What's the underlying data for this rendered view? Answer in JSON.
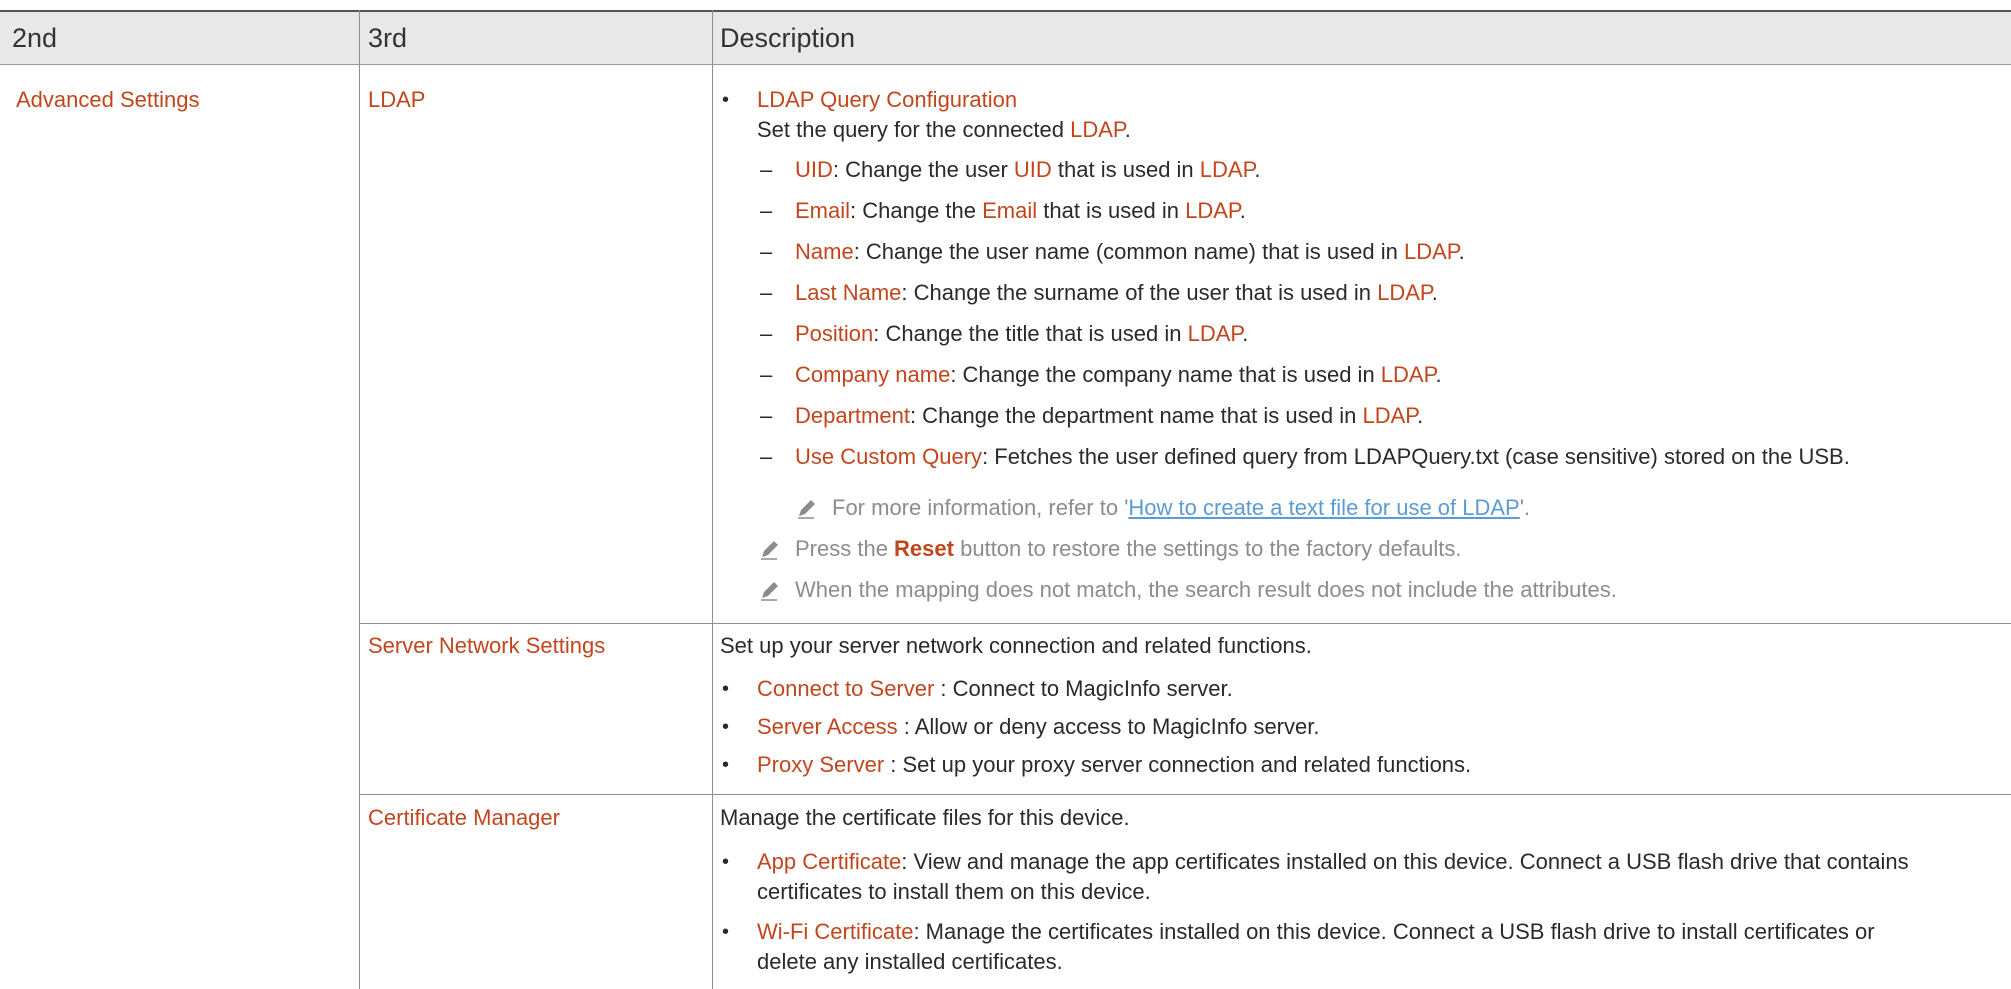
{
  "header": {
    "col1": "2nd",
    "col2": "3rd",
    "col3": "Description"
  },
  "row_group": "Advanced Settings",
  "ldap": {
    "name": "LDAP",
    "bullet_title": "LDAP Query Configuration",
    "intro_text": "Set the query for the connected ",
    "intro_hl": "LDAP",
    "intro_end": ".",
    "items": [
      {
        "term": "UID",
        "t1": ": Change the user ",
        "term2": "UID",
        "t2": " that is used in ",
        "term3": "LDAP",
        "t3": "."
      },
      {
        "term": "Email",
        "t1": ": Change the ",
        "term2": "Email",
        "t2": " that is used in ",
        "term3": "LDAP",
        "t3": "."
      },
      {
        "term": "Name",
        "t1": ": Change the user name (common name) that is used in ",
        "term3": "LDAP",
        "t3": "."
      },
      {
        "term": "Last Name",
        "t1": ": Change the surname of the user that is used in ",
        "term3": "LDAP",
        "t3": "."
      },
      {
        "term": "Position",
        "t1": ": Change the title that is used in ",
        "term3": "LDAP",
        "t3": "."
      },
      {
        "term": "Company name",
        "t1": ": Change the company name that is used in ",
        "term3": "LDAP",
        "t3": "."
      },
      {
        "term": "Department",
        "t1": ": Change the department name that is used in ",
        "term3": "LDAP",
        "t3": "."
      },
      {
        "term": "Use Custom Query",
        "t1": ": Fetches the user defined query from LDAPQuery.txt (case sensitive) stored on the USB."
      }
    ],
    "sub_note_pre": "For more information, refer to '",
    "sub_note_link": "How to create a text file for use of LDAP",
    "sub_note_post": "'.",
    "note1_pre": "Press the ",
    "note1_bold": "Reset",
    "note1_post": " button to restore the settings to the factory defaults.",
    "note2": "When the mapping does not match, the search result does not include the attributes."
  },
  "server": {
    "name": "Server Network Settings",
    "intro": "Set up your server network connection and related functions.",
    "items": [
      {
        "term": "Connect to Server",
        "text": " : Connect to MagicInfo server."
      },
      {
        "term": "Server Access",
        "text": " : Allow or deny access to MagicInfo server."
      },
      {
        "term": "Proxy Server",
        "text": " : Set up your proxy server connection and related functions."
      }
    ]
  },
  "cert": {
    "name": "Certificate Manager",
    "intro": "Manage the certificate files for this device.",
    "items": [
      {
        "term": "App Certificate",
        "line1": ": View and manage the app certificates installed on this device. Connect a USB flash drive that contains",
        "line2": "certificates to install them on this device."
      },
      {
        "term": "Wi-Fi Certificate",
        "line1": ": Manage the certificates installed on this device. Connect a USB flash drive to install certificates or",
        "line2": "delete any installed certificates."
      }
    ]
  },
  "colors": {
    "highlight": "#c2461d",
    "note": "#8c8c8c",
    "link": "#5b9bd5",
    "header_bg": "#e8e8e8"
  },
  "icons": {
    "note": "pencil-note-icon"
  }
}
